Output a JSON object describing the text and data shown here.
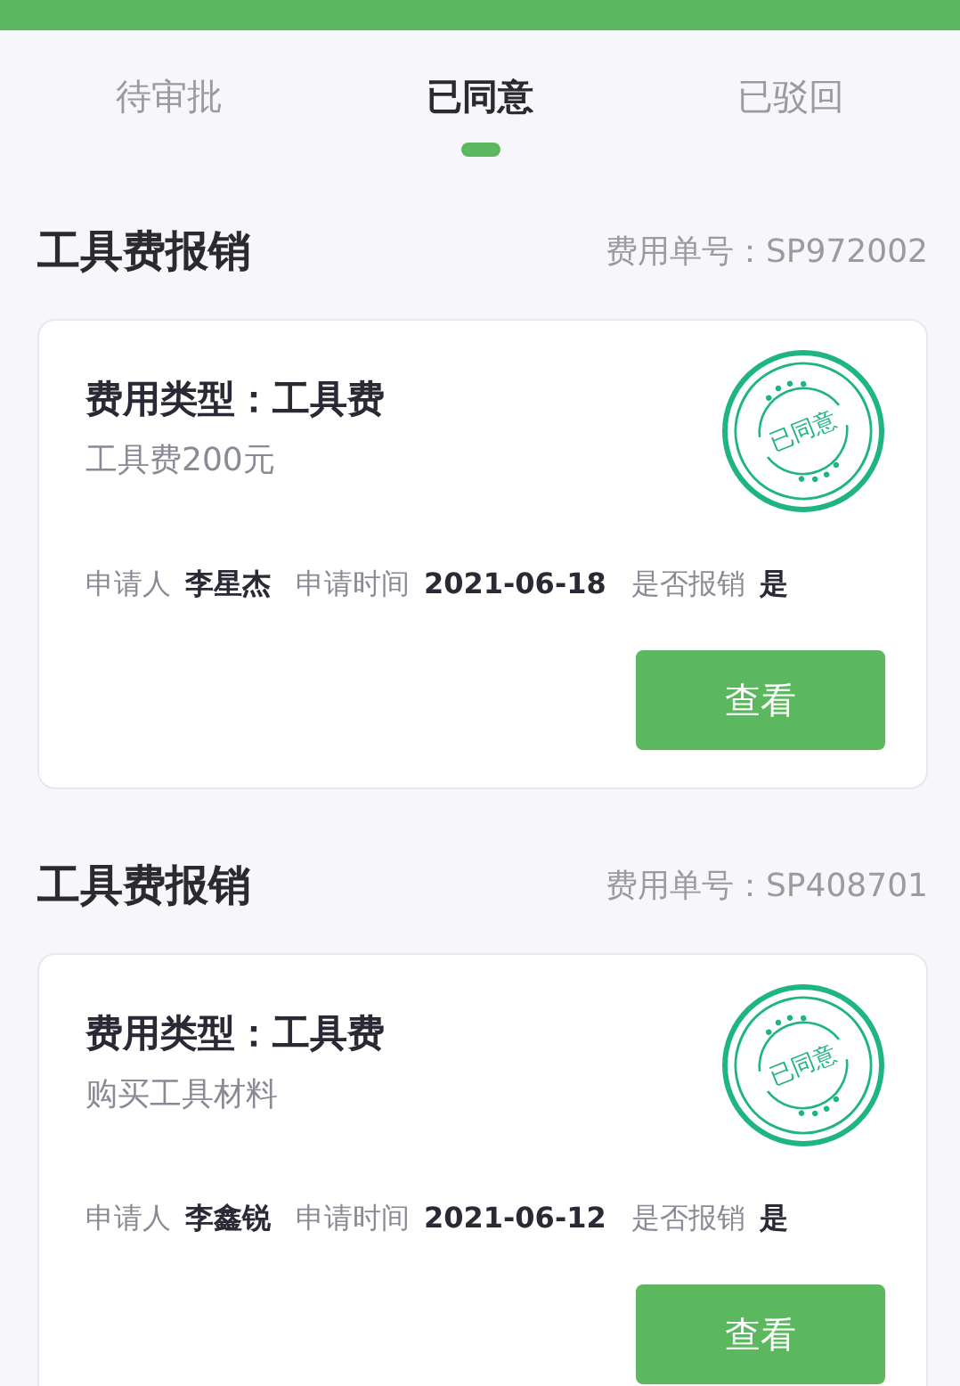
{
  "tabs": [
    {
      "label": "待审批",
      "selected": false
    },
    {
      "label": "已同意",
      "selected": true
    },
    {
      "label": "已驳回",
      "selected": false
    }
  ],
  "requests": [
    {
      "title": "工具费报销",
      "number": "费用单号：SP972002",
      "card": {
        "type_line": "费用类型：工具费",
        "description": "工具费200元",
        "stamp": "已同意",
        "fields": [
          {
            "label": "申请人",
            "value": "李星杰"
          },
          {
            "label": "申请时间",
            "value": "2021-06-18"
          },
          {
            "label": "是否报销",
            "value": "是"
          }
        ],
        "button": "查看"
      }
    },
    {
      "title": "工具费报销",
      "number": "费用单号：SP408701",
      "card": {
        "type_line": "费用类型：工具费",
        "description": "购买工具材料",
        "stamp": "已同意",
        "fields": [
          {
            "label": "申请人",
            "value": "李鑫锐"
          },
          {
            "label": "申请时间",
            "value": "2021-06-12"
          },
          {
            "label": "是否报销",
            "value": "是"
          }
        ],
        "button": "查看"
      }
    }
  ]
}
